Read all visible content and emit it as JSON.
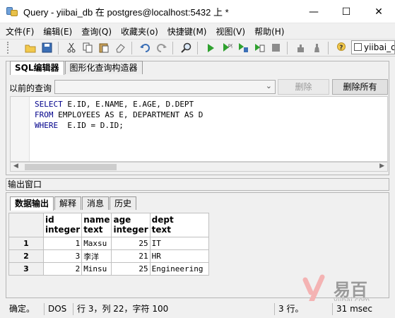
{
  "window": {
    "title": "Query - yiibai_db 在  postgres@localhost:5432 上 *",
    "minimize": "—",
    "maximize": "☐",
    "close": "✕"
  },
  "menu": [
    "文件(F)",
    "编辑(E)",
    "查询(Q)",
    "收藏夹(o)",
    "快捷键(M)",
    "视图(V)",
    "帮助(H)"
  ],
  "toolbar": {
    "icons": [
      "folder-open-icon",
      "save-icon",
      "cut-icon",
      "copy-icon",
      "paste-icon",
      "eraser-icon",
      "undo-icon",
      "redo-icon",
      "find-icon",
      "execute-icon",
      "execute-script-icon",
      "explain-icon",
      "execute-file-icon",
      "stop-icon",
      "explain-analyze-icon",
      "vacuum-icon",
      "help-icon"
    ],
    "server_label": "yiibai_d"
  },
  "top_tabs": [
    "SQL编辑器",
    "图形化查询构造器"
  ],
  "history": {
    "label": "以前的查询",
    "value": "",
    "delete_button": "删除",
    "delete_all_button": "删除所有"
  },
  "editor": {
    "lines": [
      {
        "kw": "SELECT",
        "rest": " E.ID, E.NAME, E.AGE, D.DEPT"
      },
      {
        "kw": "FROM",
        "rest": " EMPLOYEES AS E, DEPARTMENT AS D"
      },
      {
        "kw": "WHERE",
        "rest": "  E.ID = D.ID;"
      }
    ]
  },
  "output": {
    "title": "输出窗口",
    "tabs": [
      "数据输出",
      "解释",
      "消息",
      "历史"
    ],
    "columns": [
      {
        "name": "id",
        "type": "integer"
      },
      {
        "name": "name",
        "type": "text"
      },
      {
        "name": "age",
        "type": "integer"
      },
      {
        "name": "dept",
        "type": "text"
      }
    ],
    "rows": [
      {
        "n": "1",
        "id": "1",
        "name": "Maxsu",
        "age": "25",
        "dept": "IT"
      },
      {
        "n": "2",
        "id": "3",
        "name": "李洋",
        "age": "21",
        "dept": "HR"
      },
      {
        "n": "3",
        "id": "2",
        "name": "Minsu",
        "age": "25",
        "dept": "Engineering"
      }
    ]
  },
  "status": {
    "state": "确定。",
    "encoding": "DOS",
    "position": "行 3，列 22，字符 100",
    "rows": "3 行。",
    "time": "31 msec"
  },
  "watermark": {
    "text": "易百",
    "domain": "yiibai.com"
  }
}
